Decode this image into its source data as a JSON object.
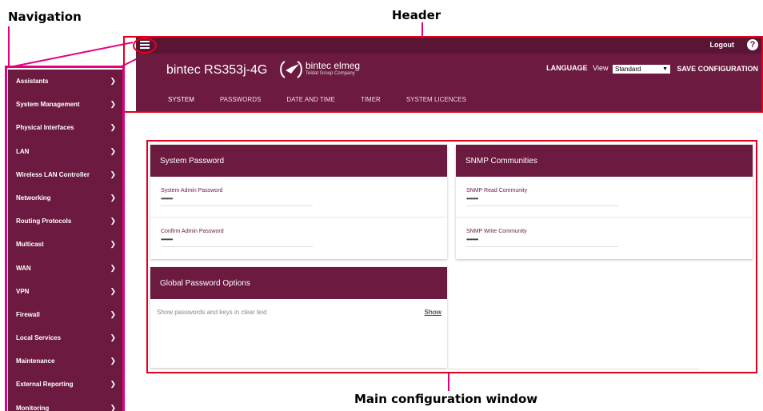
{
  "callouts": {
    "navigation": "Navigation",
    "header": "Header",
    "main": "Main configuration window"
  },
  "header": {
    "product": "bintec  RS353j-4G",
    "logo_text": "bintec elmeg",
    "logo_sub": "Teldat Group Company",
    "logout": "Logout",
    "help": "?",
    "language": "LANGUAGE",
    "view_label": "View",
    "view_selected": "Standard",
    "save": "SAVE CONFIGURATION",
    "tabs": [
      "SYSTEM",
      "PASSWORDS",
      "DATE AND TIME",
      "TIMER",
      "SYSTEM LICENCES"
    ]
  },
  "sidebar": {
    "items": [
      "Assistants",
      "System Management",
      "Physical Interfaces",
      "LAN",
      "Wireless LAN Controller",
      "Networking",
      "Routing Protocols",
      "Multicast",
      "WAN",
      "VPN",
      "Firewall",
      "Local Services",
      "Maintenance",
      "External Reporting",
      "Monitoring"
    ]
  },
  "system_password": {
    "title": "System Password",
    "admin_label": "System Admin Password",
    "admin_value": "••••••••",
    "confirm_label": "Confirm Admin Password",
    "confirm_value": "••••••••"
  },
  "snmp": {
    "title": "SNMP Communities",
    "read_label": "SNMP Read Community",
    "read_value": "••••••••",
    "write_label": "SNMP Write Community",
    "write_value": "••••••••"
  },
  "global_pw": {
    "title": "Global Password Options",
    "row_text": "Show passwords and keys in clear text",
    "show_link": "Show"
  },
  "colors": {
    "brand": "#6c1a3f",
    "callout_box": "#e3001b",
    "callout_line": "#e6007e"
  }
}
